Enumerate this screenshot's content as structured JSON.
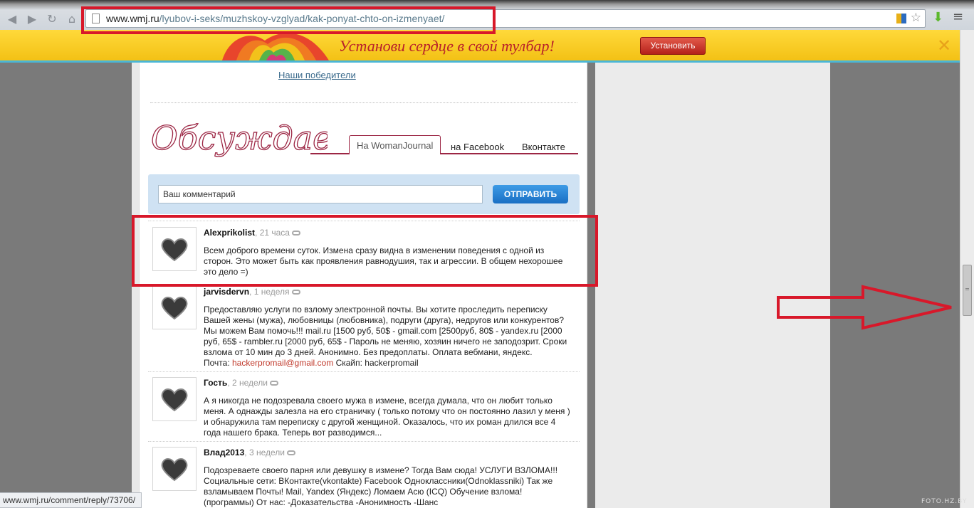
{
  "browser": {
    "url_host": "www.wmj.ru",
    "url_path": "/lyubov-i-seks/muzhskoy-vzglyad/kak-ponyat-chto-on-izmenyaet/",
    "status_url": "www.wmj.ru/comment/reply/73706/",
    "watermark": "FOTO.HZ.BY"
  },
  "promo": {
    "text": "Установи сердце в свой тулбар!",
    "button": "Установить"
  },
  "page": {
    "winners_link": "Наши победители",
    "discuss_title": "Обсуждаем",
    "tabs": [
      "На WomanJournal",
      "на Facebook",
      "Вконтакте"
    ],
    "comment_placeholder": "Ваш комментарий",
    "submit_label": "ОТПРАВИТЬ"
  },
  "comments": [
    {
      "author": "Alexprikolist",
      "time": ", 21 часа",
      "text": "Всем доброго времени суток. Измена сразу видна в изменении поведения с одной из сторон. Это может быть как проявления равнодушия, так и агрессии. В общем нехорошее это дело =)"
    },
    {
      "author": "jarvisdervn",
      "time": ", 1 неделя",
      "text": "Предоставляю услуги по взлому электронной почты. Вы хотите проследить переписку Вашей жены (мужа), любовницы (любовника), подруги (друга), недругов или конкурентов? Мы можем Вам помочь!!! mail.ru [1500 руб, 50$ - gmail.com [2500руб, 80$ - yandex.ru [2000 руб, 65$ - rambler.ru [2000 руб, 65$ - Пароль не меняю, хозяин ничего не заподозрит. Сроки взлома от 10 мин до 3 дней. Анонимно. Без предоплаты. Оплата вебмани, яндекс.",
      "email_prefix": "Почта: ",
      "email": "hackerpromail@gmail.com",
      "skype": " Скайп: hackerpromail"
    },
    {
      "author": "Гость",
      "time": ", 2 недели",
      "text": "А я никогда не подозревала своего мужа в измене, всегда думала, что он любит только меня. А однажды залезла на его страничку ( только потому что он постоянно лазил у меня ) и обнаружила там переписку с другой женщиной. Оказалось, что их роман длился все 4 года нашего брака. Теперь вот разводимся..."
    },
    {
      "author": "Влад2013",
      "time": ", 3 недели",
      "text": "Подозреваете своего парня или девушку в измене? Тогда Вам сюда! УСЛУГИ ВЗЛОМА!!! Социальные сети: ВКонтакте(vkontakte) Facebook Одноклассники(Odnoklassniki) Так же взламываем Почты! Mail, Yandex (Яндекс) Ломаем Асю (ICQ) Обучение взлома! (программы) От нас: -Доказательства -Анонимность -Шанс"
    }
  ],
  "colors": {
    "annotation_red": "#d8182a",
    "promo_yellow": "#f3c115",
    "tab_accent": "#9c2644"
  }
}
